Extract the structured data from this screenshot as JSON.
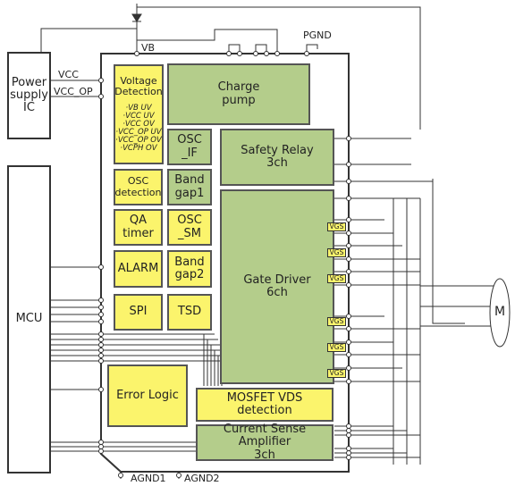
{
  "diagram": {
    "external_blocks": {
      "power_supply_ic": {
        "label": "Power\nsupply\nIC"
      },
      "mcu": {
        "label": "MCU"
      }
    },
    "pins": {
      "vcc": "VCC",
      "vcc_op": "VCC_OP",
      "vb": "VB",
      "pgnd": "PGND",
      "agnd1": "AGND1",
      "agnd2": "AGND2"
    },
    "internal_blocks": {
      "voltage_detection": {
        "label": "Voltage\nDetection",
        "items": [
          "·VB UV",
          "·VCC UV",
          "·VCC OV",
          "·VCC_OP UV",
          "·VCC_OP OV",
          "·VCPH OV"
        ]
      },
      "charge_pump": {
        "label": "Charge\npump"
      },
      "osc_if": {
        "label": "OSC\n_IF"
      },
      "safety_relay": {
        "label": "Safety Relay\n3ch"
      },
      "osc_detection": {
        "label": "OSC\ndetection"
      },
      "band_gap1": {
        "label": "Band\ngap1"
      },
      "qa_timer": {
        "label": "QA\ntimer"
      },
      "osc_sm": {
        "label": "OSC\n_SM"
      },
      "alarm": {
        "label": "ALARM"
      },
      "band_gap2": {
        "label": "Band\ngap2"
      },
      "spi": {
        "label": "SPI"
      },
      "tsd": {
        "label": "TSD"
      },
      "gate_driver": {
        "label": "Gate  Driver\n6ch"
      },
      "error_logic": {
        "label": "Error Logic"
      },
      "mosfet_vds_detection": {
        "label": "MOSFET VDS detection"
      },
      "current_sense_amplifier": {
        "label": "Current Sense Amplifier\n3ch"
      }
    },
    "vgs_labels": [
      "VGS",
      "VGS",
      "VGS",
      "VGS",
      "VGS",
      "VGS"
    ],
    "motor": {
      "label": "M"
    },
    "colors": {
      "yellow_block": "#fbf46c",
      "green_block": "#b4cd8b",
      "wire": "#333333"
    }
  }
}
